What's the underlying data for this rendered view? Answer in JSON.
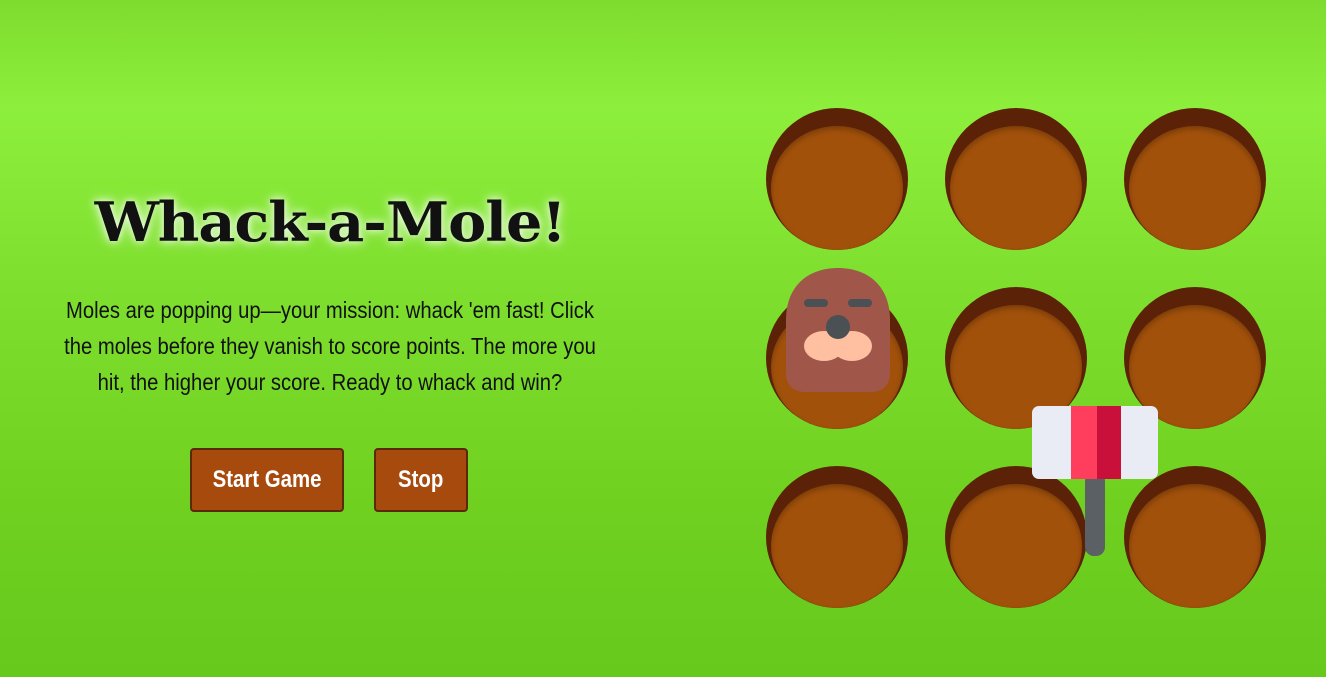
{
  "game": {
    "title": "Whack-a-Mole!",
    "description": "Moles are popping up—your mission: whack 'em fast! Click the moles before they vanish to score points. The more you hit, the higher your score. Ready to whack and win?",
    "buttons": {
      "start_label": "Start Game",
      "stop_label": "Stop"
    }
  },
  "board": {
    "rows": 3,
    "cols": 3,
    "holes": [
      {
        "id": 1,
        "has_mole": false
      },
      {
        "id": 2,
        "has_mole": false
      },
      {
        "id": 3,
        "has_mole": false
      },
      {
        "id": 4,
        "has_mole": true
      },
      {
        "id": 5,
        "has_mole": false
      },
      {
        "id": 6,
        "has_mole": false
      },
      {
        "id": 7,
        "has_mole": false
      },
      {
        "id": 8,
        "has_mole": false
      },
      {
        "id": 9,
        "has_mole": false
      }
    ]
  },
  "icons": {
    "mole": "mole-icon",
    "hammer": "hammer-cursor-icon"
  },
  "colors": {
    "background": "#80e030",
    "hole_rim": "#5b2208",
    "hole_fill": "#a2510b",
    "button": "#a64a0e",
    "mole": "#a0574a",
    "hammer_head": "#e9ecf4",
    "hammer_stripe": "#ff3e5e"
  }
}
